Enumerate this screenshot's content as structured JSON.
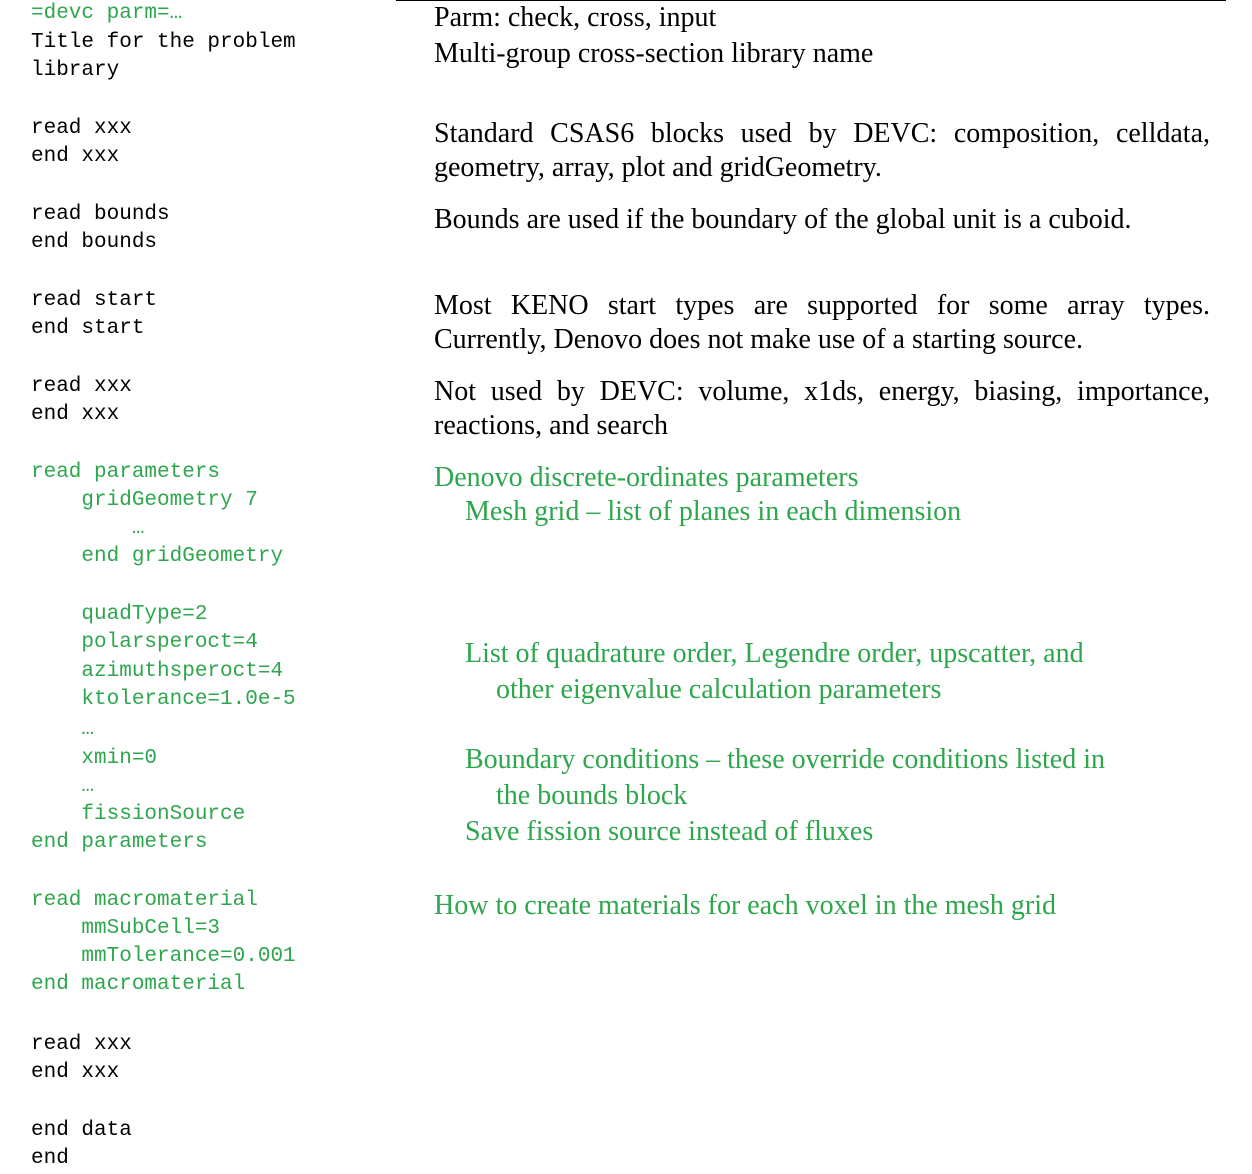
{
  "colors": {
    "text": "#000000",
    "highlight": "#2ea64d"
  },
  "code": {
    "devc_parm": "=devc parm=…",
    "title_line": "Title for the problem",
    "library_line": "library",
    "read_xxx_1": "read xxx",
    "end_xxx_1": "end xxx",
    "read_bounds": "read bounds",
    "end_bounds": "end bounds",
    "read_start": "read start",
    "end_start": "end start",
    "read_xxx_2": "read xxx",
    "end_xxx_2": "end xxx",
    "read_parameters": "read parameters",
    "grid_geometry": "    gridGeometry 7",
    "ellipsis_1": "        …",
    "end_grid_geometry": "    end gridGeometry",
    "quad_type": "    quadType=2",
    "polarsperoct": "    polarsperoct=4",
    "azimuthsperoct": "    azimuthsperoct=4",
    "ktolerance": "    ktolerance=1.0e-5",
    "ellipsis_2": "    …",
    "xmin": "    xmin=0",
    "ellipsis_3": "    …",
    "fission_source": "    fissionSource",
    "end_parameters": "end parameters",
    "read_macromaterial": "read macromaterial",
    "mm_subcell": "    mmSubCell=3",
    "mm_tolerance": "    mmTolerance=0.001",
    "end_macromaterial": "end macromaterial",
    "read_xxx_3": "read xxx",
    "end_xxx_3": "end xxx",
    "end_data": "end data",
    "end": "end"
  },
  "descriptions": {
    "parm": "Parm: check, cross, input",
    "library": "Multi-group cross-section library name",
    "csas6_blocks": "Standard CSAS6 blocks used by DEVC: composition, celldata, geometry, array, plot and gridGeometry.",
    "bounds": "Bounds are used if the boundary of the global unit is a cuboid.",
    "start": "Most KENO start types are supported for some array types. Currently, Denovo does not make use of a starting source.",
    "not_used": "Not used by DEVC: volume, x1ds, energy, biasing, importance, reactions, and search",
    "denovo_params": "Denovo discrete-ordinates parameters",
    "mesh_grid": "Mesh grid – list of planes in each dimension",
    "quadrature_1": "List of quadrature order, Legendre order, upscatter, and",
    "quadrature_2": "other eigenvalue calculation parameters",
    "boundary_1": "Boundary conditions – these override conditions listed in",
    "boundary_2": "the bounds block",
    "fission": "Save fission source instead of fluxes",
    "macromaterial": "How to create materials for each voxel in the mesh grid"
  }
}
